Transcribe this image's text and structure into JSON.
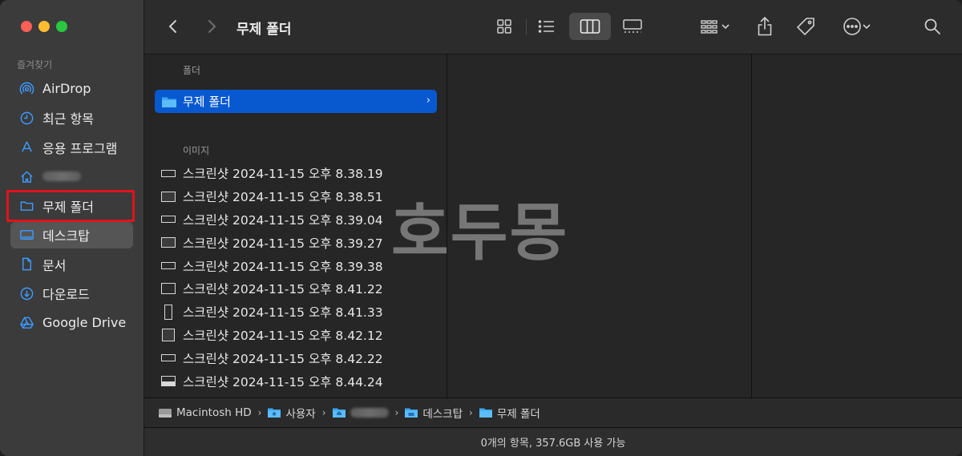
{
  "sidebar": {
    "section_title": "즐겨찾기",
    "items": [
      {
        "label": "AirDrop",
        "icon": "airdrop-icon"
      },
      {
        "label": "최근 항목",
        "icon": "clock-icon"
      },
      {
        "label": "응용 프로그램",
        "icon": "applications-icon"
      },
      {
        "label": "",
        "icon": "home-icon"
      },
      {
        "label": "무제 폴더",
        "icon": "folder-icon"
      },
      {
        "label": "데스크탑",
        "icon": "desktop-icon"
      },
      {
        "label": "문서",
        "icon": "document-icon"
      },
      {
        "label": "다운로드",
        "icon": "download-icon"
      },
      {
        "label": "Google Drive",
        "icon": "google-drive-icon"
      }
    ]
  },
  "toolbar": {
    "title": "무제 폴더"
  },
  "column1": {
    "folders_header": "폴더",
    "selected_folder": "무제 폴더",
    "images_header": "이미지",
    "files": [
      "스크린샷 2024-11-15 오후 8.38.19",
      "스크린샷 2024-11-15 오후 8.38.51",
      "스크린샷 2024-11-15 오후 8.39.04",
      "스크린샷 2024-11-15 오후 8.39.27",
      "스크린샷 2024-11-15 오후 8.39.38",
      "스크린샷 2024-11-15 오후 8.41.22",
      "스크린샷 2024-11-15 오후 8.41.33",
      "스크린샷 2024-11-15 오후 8.42.12",
      "스크린샷 2024-11-15 오후 8.42.22",
      "스크린샷 2024-11-15 오후 8.44.24"
    ]
  },
  "watermark": "호두몽",
  "pathbar": {
    "crumbs": [
      "Macintosh HD",
      "사용자",
      "",
      "데스크탑",
      "무제 폴더"
    ]
  },
  "status": "0개의 항목, 357.6GB 사용 가능",
  "colors": {
    "accent": "#0859d0",
    "highlight_box": "#e0141a",
    "folder": "#3ba7f3"
  }
}
